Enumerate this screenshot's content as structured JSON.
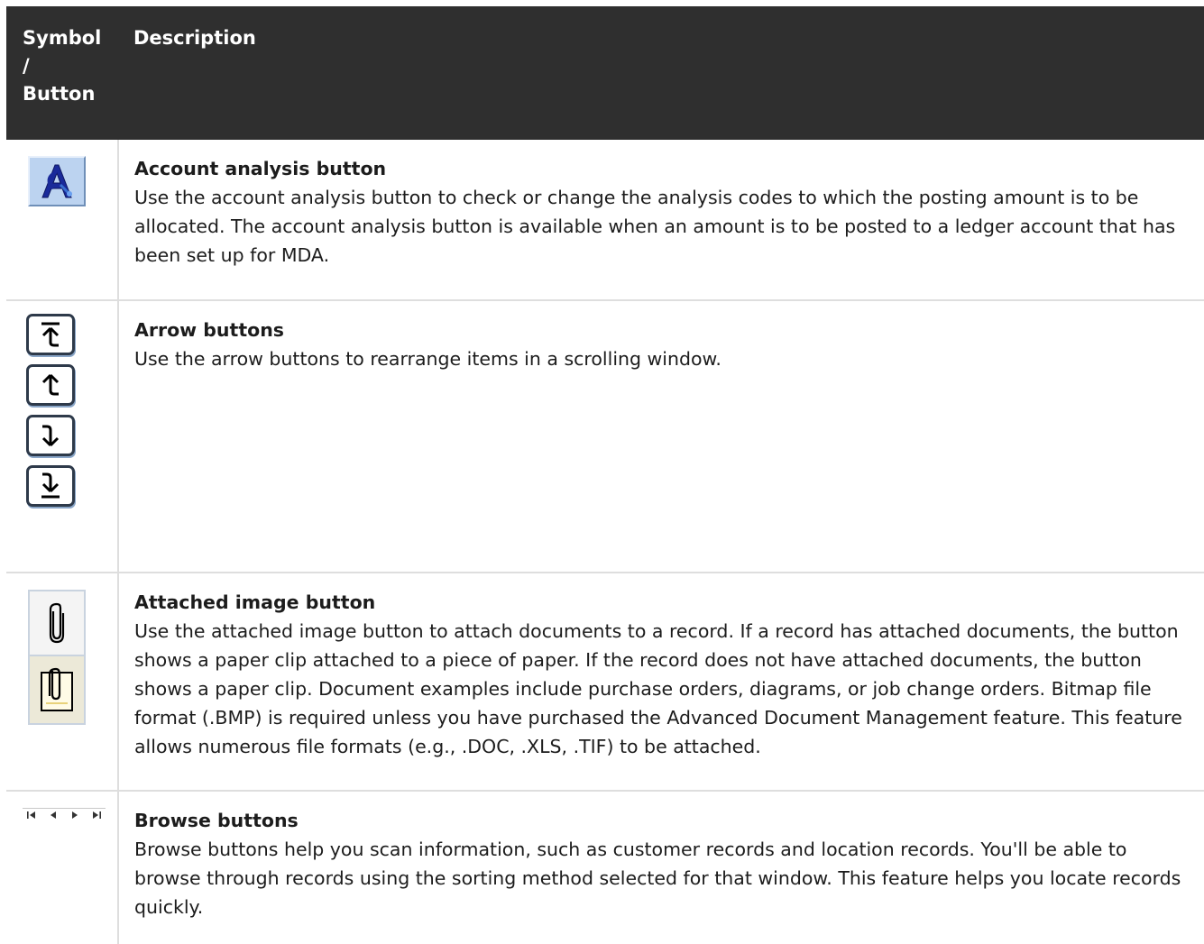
{
  "header": {
    "symbol_col_line1": "Symbol",
    "symbol_col_line2": "/",
    "symbol_col_line3": "Button",
    "description_col": "Description"
  },
  "rows": [
    {
      "icon": "account-analysis-icon",
      "title": "Account analysis button",
      "text": "Use the account analysis button to check or change the analysis codes to which the posting amount is to be allocated. The account analysis button is available when an amount is to be posted to a ledger account that has been set up for MDA."
    },
    {
      "icon": "arrow-buttons-icons",
      "title": "Arrow buttons",
      "text": "Use the arrow buttons to rearrange items in a scrolling window."
    },
    {
      "icon": "paper-clip-icon",
      "title": "Attached image button",
      "text": "Use the attached image button to attach documents to a record. If a record has attached documents, the button shows a paper clip attached to a piece of paper. If the record does not have attached documents, the button shows a paper clip. Document examples include purchase orders, diagrams, or job change orders. Bitmap file format (.BMP) is required unless you have purchased the Advanced Document Management feature. This feature allows numerous file formats (e.g., .DOC, .XLS, .TIF) to be attached."
    },
    {
      "icon": "browse-buttons-icons",
      "title": "Browse buttons",
      "text": "Browse buttons help you scan information, such as customer records and location records. You'll be able to browse through records using the sorting method selected for that window. This feature helps you locate records quickly."
    }
  ]
}
